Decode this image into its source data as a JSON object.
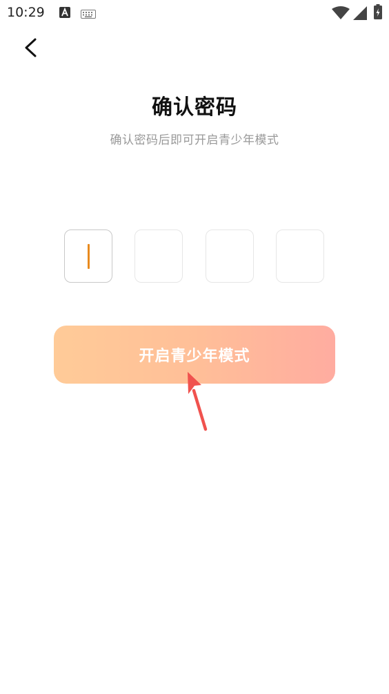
{
  "status_bar": {
    "time": "10:29",
    "icons": [
      "notification-a-icon",
      "keyboard-icon",
      "wifi-icon",
      "signal-icon",
      "battery-icon"
    ]
  },
  "nav": {
    "back_icon": "chevron-left-icon"
  },
  "header": {
    "title": "确认密码",
    "subtitle": "确认密码后即可开启青少年模式"
  },
  "pin": {
    "length": 4,
    "values": [
      "",
      "",
      "",
      ""
    ],
    "cursor_color": "#e88a1e"
  },
  "action": {
    "label": "开启青少年模式"
  },
  "colors": {
    "button_gradient_start": "#ffcb98",
    "button_gradient_end": "#ffaca0",
    "annotation_arrow": "#f0524e"
  }
}
